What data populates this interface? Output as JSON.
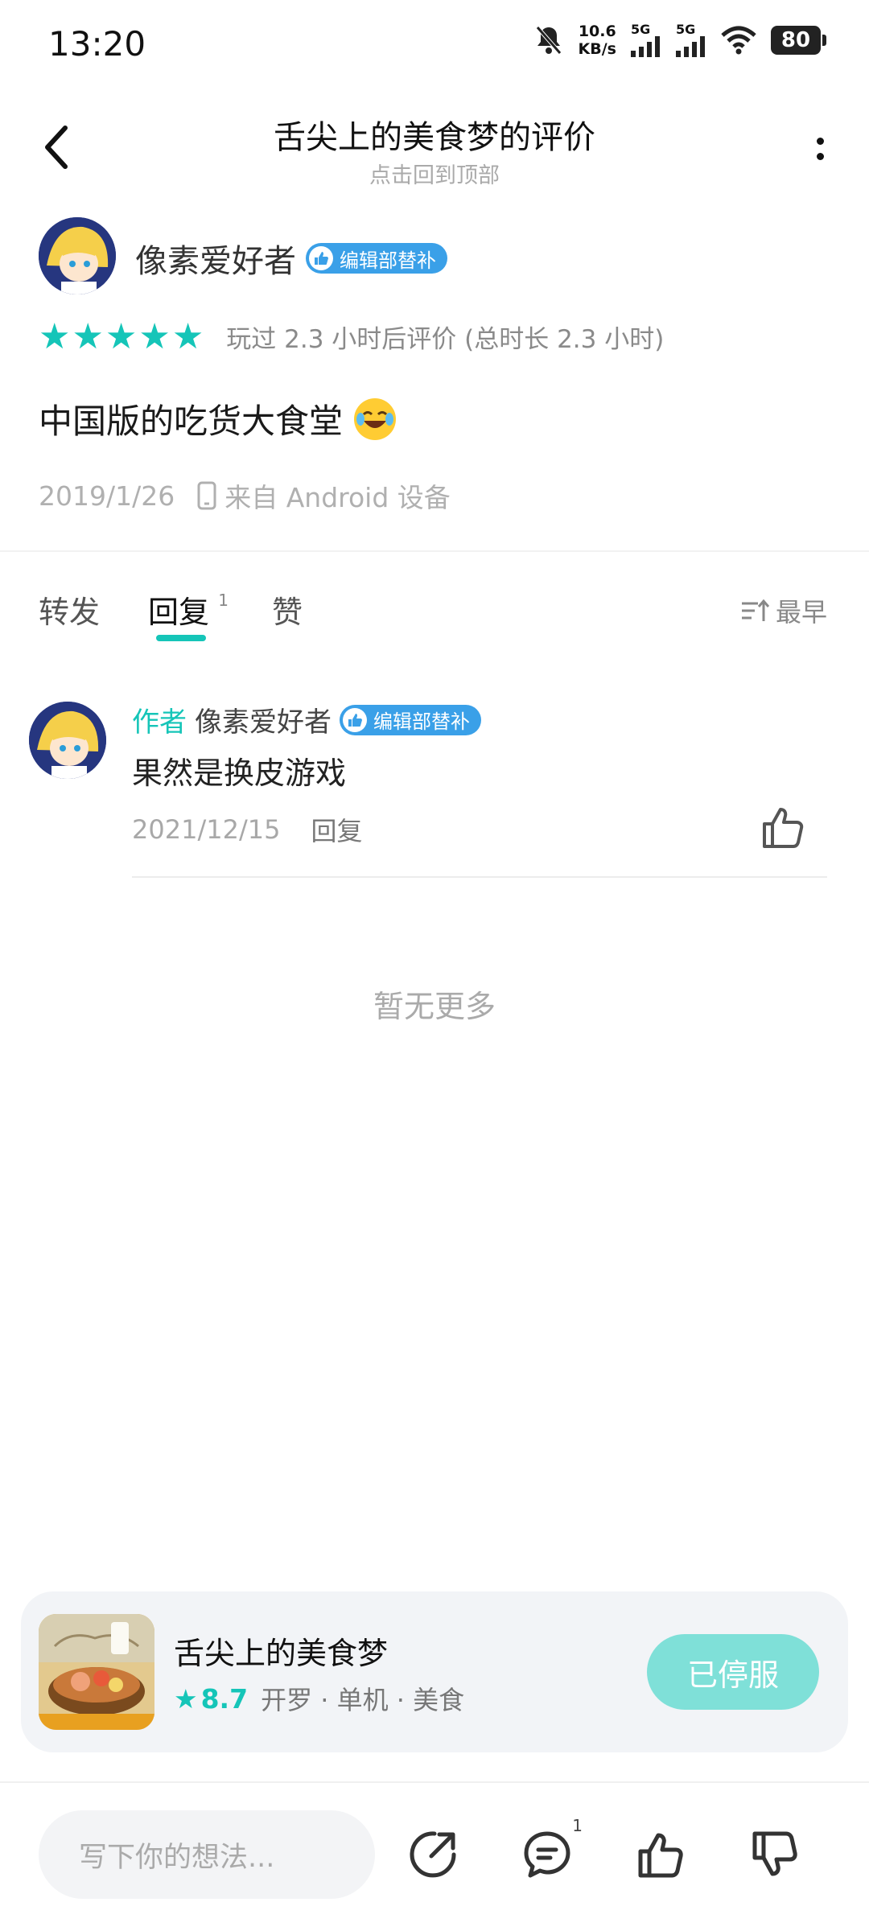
{
  "status": {
    "time": "13:20",
    "net_speed_value": "10.6",
    "net_speed_unit": "KB/s",
    "sim1": "5G",
    "sim2": "5G",
    "battery": "80"
  },
  "header": {
    "title": "舌尖上的美食梦的评价",
    "subtitle": "点击回到顶部"
  },
  "review": {
    "username": "像素爱好者",
    "badge": "编辑部替补",
    "stars": 5,
    "play_info": "玩过 2.3 小时后评价 (总时长 2.3 小时)",
    "text": "中国版的吃货大食堂",
    "date": "2019/1/26",
    "device": "来自 Android 设备"
  },
  "tabs": {
    "forward": "转发",
    "reply": "回复",
    "reply_count": "1",
    "like": "赞",
    "sort": "最早"
  },
  "reply": {
    "author_tag": "作者",
    "username": "像素爱好者",
    "badge": "编辑部替补",
    "text": "果然是换皮游戏",
    "date": "2021/12/15",
    "action": "回复"
  },
  "no_more": "暂无更多",
  "game": {
    "name": "舌尖上的美食梦",
    "score": "8.7",
    "tags": "开罗 · 单机 · 美食",
    "button": "已停服"
  },
  "bottom_bar": {
    "placeholder": "写下你的想法...",
    "comment_count": "1"
  },
  "colors": {
    "accent": "#15c5b8",
    "badge": "#3aa0e8",
    "stopped_button": "#7fe0d8"
  }
}
